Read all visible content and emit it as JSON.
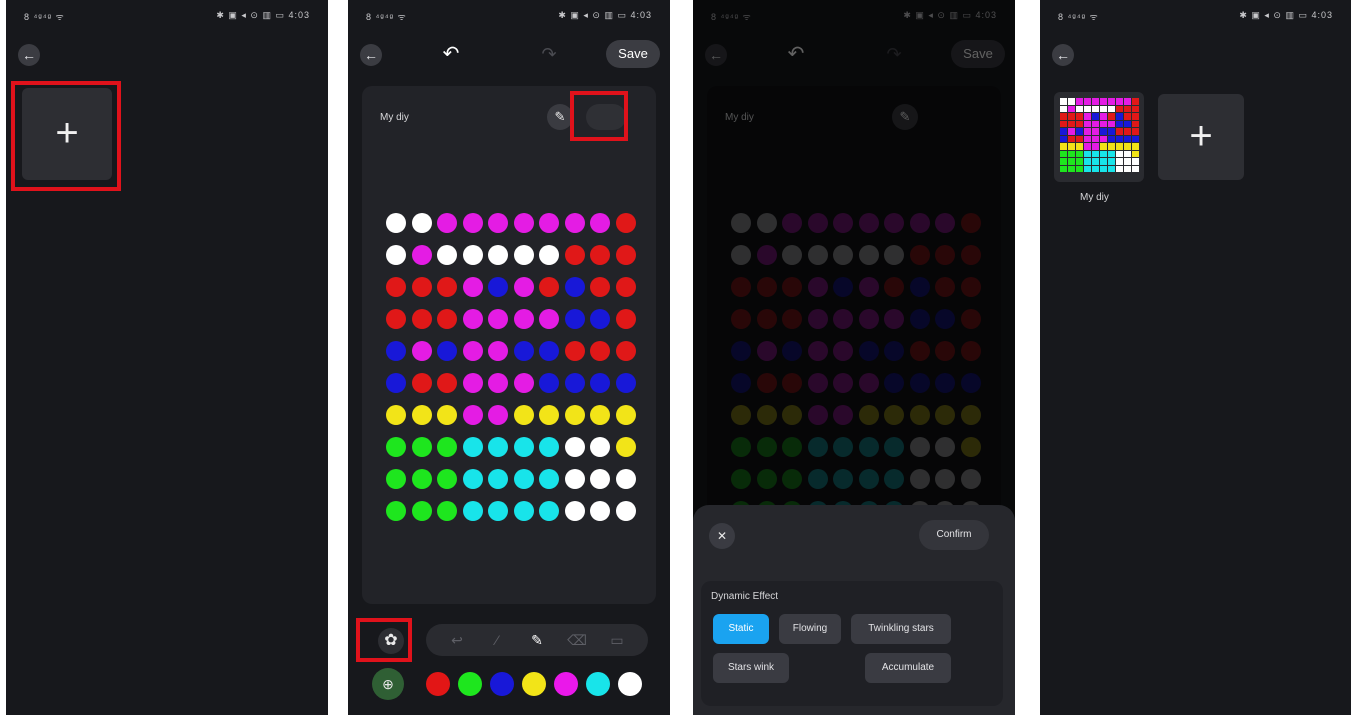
{
  "status_bar": {
    "left": "8 ⁴ᵍ⁴ᵍ ᯤ",
    "right": "✱ ▣ ◂ ⊙ ▥ ▭ 4:03"
  },
  "panel1": {
    "add_label": "+"
  },
  "panel2": {
    "undo_label": "↶",
    "redo_label": "↷",
    "save_label": "Save",
    "name": "My diy",
    "edit_label": "✎",
    "faded_button_label": "",
    "settings_label": "✿",
    "tools": [
      "undo-tool",
      "eyedropper-tool",
      "pen-tool",
      "eraser-tool",
      "delete-tool"
    ],
    "palette": [
      "#e21616",
      "#1ee61e",
      "#1818d8",
      "#f2e418",
      "#ea18ea",
      "#18e4ea",
      "#ffffff"
    ],
    "color_picker_label": "⊕"
  },
  "grid_colors": [
    [
      "#ffffff",
      "#ffffff",
      "#e41ce4",
      "#e41ce4",
      "#e41ce4",
      "#e41ce4",
      "#e41ce4",
      "#e41ce4",
      "#e41ce4",
      "#e01818"
    ],
    [
      "#ffffff",
      "#e41ce4",
      "#ffffff",
      "#ffffff",
      "#ffffff",
      "#ffffff",
      "#ffffff",
      "#e01818",
      "#e01818",
      "#e01818"
    ],
    [
      "#e01818",
      "#e01818",
      "#e01818",
      "#e41ce4",
      "#1818d8",
      "#e41ce4",
      "#e01818",
      "#1818d8",
      "#e01818",
      "#e01818"
    ],
    [
      "#e01818",
      "#e01818",
      "#e01818",
      "#e41ce4",
      "#e41ce4",
      "#e41ce4",
      "#e41ce4",
      "#1818d8",
      "#1818d8",
      "#e01818"
    ],
    [
      "#1818d8",
      "#e41ce4",
      "#1818d8",
      "#e41ce4",
      "#e41ce4",
      "#1818d8",
      "#1818d8",
      "#e01818",
      "#e01818",
      "#e01818"
    ],
    [
      "#1818d8",
      "#e01818",
      "#e01818",
      "#e41ce4",
      "#e41ce4",
      "#e41ce4",
      "#1818d8",
      "#1818d8",
      "#1818d8",
      "#1818d8"
    ],
    [
      "#f2e418",
      "#f2e418",
      "#f2e418",
      "#e41ce4",
      "#e41ce4",
      "#f2e418",
      "#f2e418",
      "#f2e418",
      "#f2e418",
      "#f2e418"
    ],
    [
      "#1ee61e",
      "#1ee61e",
      "#1ee61e",
      "#18e4ea",
      "#18e4ea",
      "#18e4ea",
      "#18e4ea",
      "#ffffff",
      "#ffffff",
      "#f2e418"
    ],
    [
      "#1ee61e",
      "#1ee61e",
      "#1ee61e",
      "#18e4ea",
      "#18e4ea",
      "#18e4ea",
      "#18e4ea",
      "#ffffff",
      "#ffffff",
      "#ffffff"
    ],
    [
      "#1ee61e",
      "#1ee61e",
      "#1ee61e",
      "#18e4ea",
      "#18e4ea",
      "#18e4ea",
      "#18e4ea",
      "#ffffff",
      "#ffffff",
      "#ffffff"
    ]
  ],
  "panel3": {
    "close_label": "✕",
    "confirm_label": "Confirm",
    "section_title": "Dynamic Effect",
    "effects": [
      "Static",
      "Flowing",
      "Twinkling stars",
      "Stars wink",
      "Accumulate"
    ],
    "selected_effect": "Static",
    "accent": "#1aa3f0"
  },
  "panel4": {
    "tile_name": "My diy",
    "add_label": "+"
  }
}
